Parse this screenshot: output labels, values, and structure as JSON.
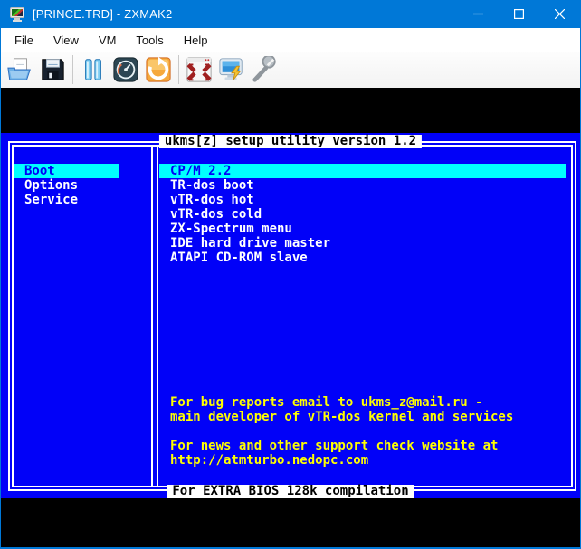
{
  "window": {
    "title": "[PRINCE.TRD] - ZXMAK2",
    "accent": "#0078d7"
  },
  "menubar": {
    "items": [
      "File",
      "View",
      "VM",
      "Tools",
      "Help"
    ]
  },
  "toolbar": {
    "icons": [
      "open",
      "save",
      "pause",
      "speed",
      "reset",
      "fullscreen",
      "power",
      "settings"
    ]
  },
  "screen": {
    "title": "ukms[z] setup utility version 1.2",
    "left_menu": [
      {
        "label": "Boot",
        "selected": true
      },
      {
        "label": "Options",
        "selected": false
      },
      {
        "label": "Service",
        "selected": false
      }
    ],
    "items": [
      "CP/M 2.2",
      "TR-dos boot",
      "vTR-dos hot",
      "vTR-dos cold",
      "ZX-Spectrum menu",
      "IDE hard drive master",
      "ATAPI CD-ROM slave"
    ],
    "selected_item": "CP/M 2.2",
    "info_lines": [
      "For bug reports email to ukms_z@mail.ru -",
      "main developer of vTR-dos kernel and services",
      "",
      "For news and other support check website at",
      "http://atmturbo.nedopc.com"
    ],
    "status": "For EXTRA BIOS 128k compilation",
    "colors": {
      "background": "#0101f8",
      "highlight": "#00ffff",
      "text": "#ffffff",
      "info": "#ffff00",
      "accent": "#0078d7"
    }
  }
}
